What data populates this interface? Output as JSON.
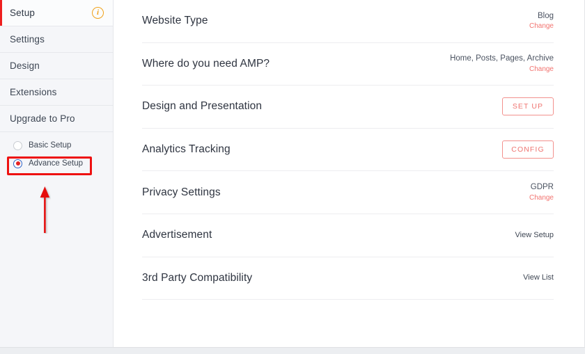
{
  "sidebar": {
    "nav_items": [
      {
        "label": "Setup",
        "active": true,
        "icon": "info-icon"
      },
      {
        "label": "Settings",
        "active": false
      },
      {
        "label": "Design",
        "active": false
      },
      {
        "label": "Extensions",
        "active": false
      },
      {
        "label": "Upgrade to Pro",
        "active": false
      }
    ],
    "setup_mode": {
      "options": [
        {
          "label": "Basic Setup",
          "selected": false
        },
        {
          "label": "Advance Setup",
          "selected": true
        }
      ]
    }
  },
  "main": {
    "rows": [
      {
        "title": "Website Type",
        "kind": "value",
        "value": "Blog",
        "change_label": "Change"
      },
      {
        "title": "Where do you need AMP?",
        "kind": "value",
        "value": "Home, Posts, Pages, Archive",
        "change_label": "Change"
      },
      {
        "title": "Design and Presentation",
        "kind": "button",
        "button_label": "SET UP"
      },
      {
        "title": "Analytics Tracking",
        "kind": "button",
        "button_label": "CONFIG"
      },
      {
        "title": "Privacy Settings",
        "kind": "value",
        "value": "GDPR",
        "change_label": "Change"
      },
      {
        "title": "Advertisement",
        "kind": "link",
        "link_label": "View Setup"
      },
      {
        "title": "3rd Party Compatibility",
        "kind": "link",
        "link_label": "View List"
      }
    ]
  },
  "annotations": {
    "highlight_color": "#ee1111",
    "arrow_color": "#e51111",
    "accent_red": "#ee1f1f",
    "info_icon_color": "#f0a019",
    "button_border_color": "#f3918d",
    "change_link_color": "#f2736f"
  }
}
